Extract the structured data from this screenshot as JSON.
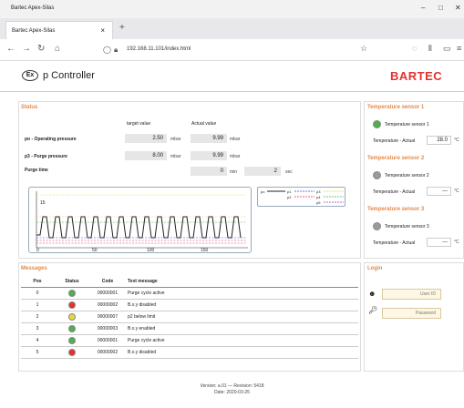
{
  "browser": {
    "window_title": "Bartec Apex-Silas",
    "tab_title": "Bartec Apex-Silas",
    "url": "192.168.11.101/index.html"
  },
  "app": {
    "title": "p Controller",
    "logo_text": "Ex",
    "brand": "BARTEC"
  },
  "status": {
    "heading": "Status",
    "col_target": "target value",
    "col_actual": "Actual value",
    "rows": [
      {
        "label": "po - Operating pressure",
        "target": "2.50",
        "target_unit": "mbar",
        "actual": "9.99",
        "actual_unit": "mbar"
      },
      {
        "label": "p3 - Purge pressure",
        "target": "8.00",
        "target_unit": "mbar",
        "actual": "9.99",
        "actual_unit": "mbar"
      }
    ],
    "purge_label": "Purge time",
    "purge_min": "0",
    "purge_min_unit": "min",
    "purge_sec": "2",
    "purge_sec_unit": "sec"
  },
  "chart_data": {
    "type": "line",
    "x_ticks": [
      "0",
      "50",
      "100",
      "150"
    ],
    "y_label_tick": "15",
    "legend": [
      "po",
      "p1",
      "p2",
      "p3",
      "p4",
      "p5"
    ],
    "xlim": [
      0,
      200
    ]
  },
  "temperature": [
    {
      "heading": "Temperature sensor 1",
      "name": "Temperature sensor 1",
      "actual_label": "Temperature - Actual",
      "value": "28.0",
      "unit": "°C",
      "led": "#4cb04c"
    },
    {
      "heading": "Temperature sensor 2",
      "name": "Temperature sensor 2",
      "actual_label": "Temperature - Actual",
      "value": "---",
      "unit": "°C",
      "led": "#9a9a9a"
    },
    {
      "heading": "Temperature sensor 3",
      "name": "Temperature sensor 3",
      "actual_label": "Temperature - Actual",
      "value": "---",
      "unit": "°C",
      "led": "#9a9a9a"
    }
  ],
  "messages": {
    "heading": "Messages",
    "columns": [
      "Pos",
      "Status",
      "Code",
      "Text message"
    ],
    "rows": [
      {
        "pos": "0",
        "status": "#4cb04c",
        "code": "00000001",
        "text": "Purge cycle active"
      },
      {
        "pos": "1",
        "status": "#e3312e",
        "code": "00000002",
        "text": "B.x.y disabled"
      },
      {
        "pos": "2",
        "status": "#e8d83a",
        "code": "00000007",
        "text": "p2 below limit"
      },
      {
        "pos": "3",
        "status": "#4cb04c",
        "code": "00000003",
        "text": "B.x.y enabled"
      },
      {
        "pos": "4",
        "status": "#4cb04c",
        "code": "00000001",
        "text": "Purge cycle active"
      },
      {
        "pos": "5",
        "status": "#e3312e",
        "code": "00000002",
        "text": "B.x.y disabled"
      }
    ]
  },
  "login": {
    "heading": "Login",
    "user_placeholder": "User ID",
    "password_placeholder": "Password"
  },
  "footer": {
    "version": "Version: a.01 — Revision: 5418",
    "date": "Date: 2020-03-25"
  }
}
